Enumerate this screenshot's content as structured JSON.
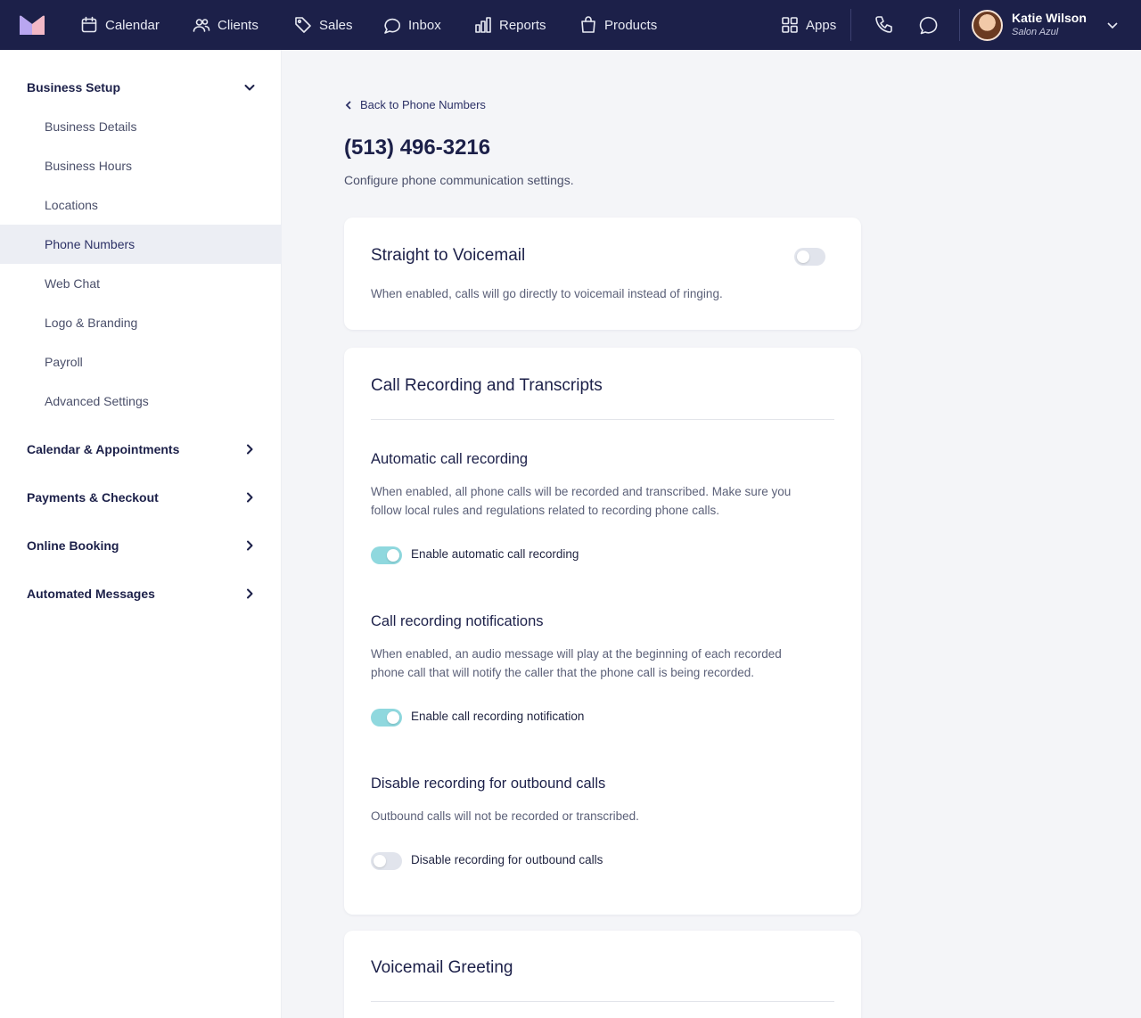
{
  "colors": {
    "nav_bg": "#1c2049",
    "toggle_on": "#8fd8de",
    "toggle_off": "#e1e4ec",
    "active_bg": "#eceef4"
  },
  "nav": {
    "items": [
      {
        "label": "Calendar",
        "icon": "calendar-icon"
      },
      {
        "label": "Clients",
        "icon": "users-icon"
      },
      {
        "label": "Sales",
        "icon": "tag-icon"
      },
      {
        "label": "Inbox",
        "icon": "chat-bubble-icon"
      },
      {
        "label": "Reports",
        "icon": "bar-chart-icon"
      },
      {
        "label": "Products",
        "icon": "shopping-bag-icon"
      }
    ],
    "apps_label": "Apps",
    "user": {
      "name": "Katie Wilson",
      "subtitle": "Salon Azul"
    }
  },
  "sidebar": {
    "business_setup": {
      "label": "Business Setup",
      "items": [
        "Business Details",
        "Business Hours",
        "Locations",
        "Phone Numbers",
        "Web Chat",
        "Logo & Branding",
        "Payroll",
        "Advanced Settings"
      ],
      "active": "Phone Numbers"
    },
    "sections": [
      "Calendar & Appointments",
      "Payments & Checkout",
      "Online Booking",
      "Automated Messages"
    ]
  },
  "main": {
    "back_label": "Back to Phone Numbers",
    "title": "(513) 496-3216",
    "subtitle": "Configure phone communication settings.",
    "voicemail_card": {
      "title": "Straight to Voicemail",
      "description": "When enabled, calls will go directly to voicemail instead of ringing.",
      "enabled": false
    },
    "recording_card": {
      "title": "Call Recording and Transcripts",
      "auto": {
        "title": "Automatic call recording",
        "description": "When enabled, all phone calls will be recorded and transcribed. Make sure you follow local rules and regulations related to recording phone calls.",
        "toggle_label": "Enable automatic call recording",
        "enabled": true
      },
      "notify": {
        "title": "Call recording notifications",
        "description": "When enabled, an audio message will play at the beginning of each recorded phone call that will notify the caller that the phone call is being recorded.",
        "toggle_label": "Enable call recording notification",
        "enabled": true
      },
      "outbound": {
        "title": "Disable recording for outbound calls",
        "description": "Outbound calls will not be recorded or transcribed.",
        "toggle_label": "Disable recording for outbound calls",
        "enabled": false
      }
    },
    "greeting_card": {
      "title": "Voicemail Greeting"
    }
  }
}
